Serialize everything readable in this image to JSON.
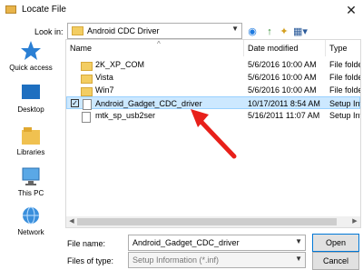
{
  "window": {
    "title": "Locate File",
    "close_glyph": "✕"
  },
  "lookin": {
    "label": "Look in:",
    "value": "Android CDC Driver"
  },
  "toolbar": {
    "back_glyph": "◉",
    "up_glyph": "↑",
    "newfolder_glyph": "✦",
    "view_glyph": "▦▾"
  },
  "places": [
    {
      "label": "Quick access",
      "icon": "star-icon"
    },
    {
      "label": "Desktop",
      "icon": "desktop-icon"
    },
    {
      "label": "Libraries",
      "icon": "libraries-icon"
    },
    {
      "label": "This PC",
      "icon": "computer-icon"
    },
    {
      "label": "Network",
      "icon": "network-icon"
    }
  ],
  "columns": {
    "name": "Name",
    "date": "Date modified",
    "type": "Type",
    "sort_glyph": "^"
  },
  "files": [
    {
      "name": "2K_XP_COM",
      "date": "5/6/2016 10:00 AM",
      "type": "File folder",
      "icon": "folder"
    },
    {
      "name": "Vista",
      "date": "5/6/2016 10:00 AM",
      "type": "File folder",
      "icon": "folder"
    },
    {
      "name": "Win7",
      "date": "5/6/2016 10:00 AM",
      "type": "File folder",
      "icon": "folder"
    },
    {
      "name": "Android_Gadget_CDC_driver",
      "date": "10/17/2011 8:54 AM",
      "type": "Setup Info",
      "icon": "file",
      "selected": true
    },
    {
      "name": "mtk_sp_usb2ser",
      "date": "5/16/2011 11:07 AM",
      "type": "Setup Info",
      "icon": "file"
    }
  ],
  "filename": {
    "label": "File name:",
    "value": "Android_Gadget_CDC_driver"
  },
  "filetype": {
    "label": "Files of type:",
    "value": "Setup Information (*.inf)"
  },
  "buttons": {
    "open": "Open",
    "cancel": "Cancel"
  },
  "annotation": {
    "color": "#e8201a"
  },
  "scroll": {
    "left": "◀",
    "right": "▶"
  }
}
